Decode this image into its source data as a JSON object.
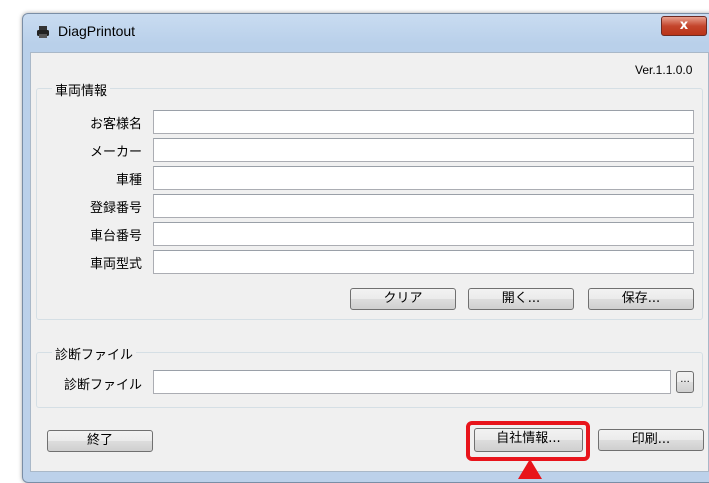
{
  "window": {
    "title": "DiagPrintout",
    "close_label": "x",
    "version": "Ver.1.1.0.0"
  },
  "vehicle_info": {
    "group_title": "車両情報",
    "fields": [
      {
        "label": "お客様名",
        "value": ""
      },
      {
        "label": "メーカー",
        "value": ""
      },
      {
        "label": "車種",
        "value": ""
      },
      {
        "label": "登録番号",
        "value": ""
      },
      {
        "label": "車台番号",
        "value": ""
      },
      {
        "label": "車両型式",
        "value": ""
      }
    ],
    "buttons": {
      "clear": "クリア",
      "open": "開く...",
      "save": "保存..."
    }
  },
  "diag_file": {
    "group_title": "診断ファイル",
    "label": "診断ファイル",
    "value": "",
    "browse": "..."
  },
  "footer": {
    "exit": "終了",
    "company_info": "自社情報...",
    "print": "印刷..."
  },
  "colors": {
    "highlight": "#e8141b",
    "frame": "#bcd1ea",
    "close": "#c4452c"
  }
}
